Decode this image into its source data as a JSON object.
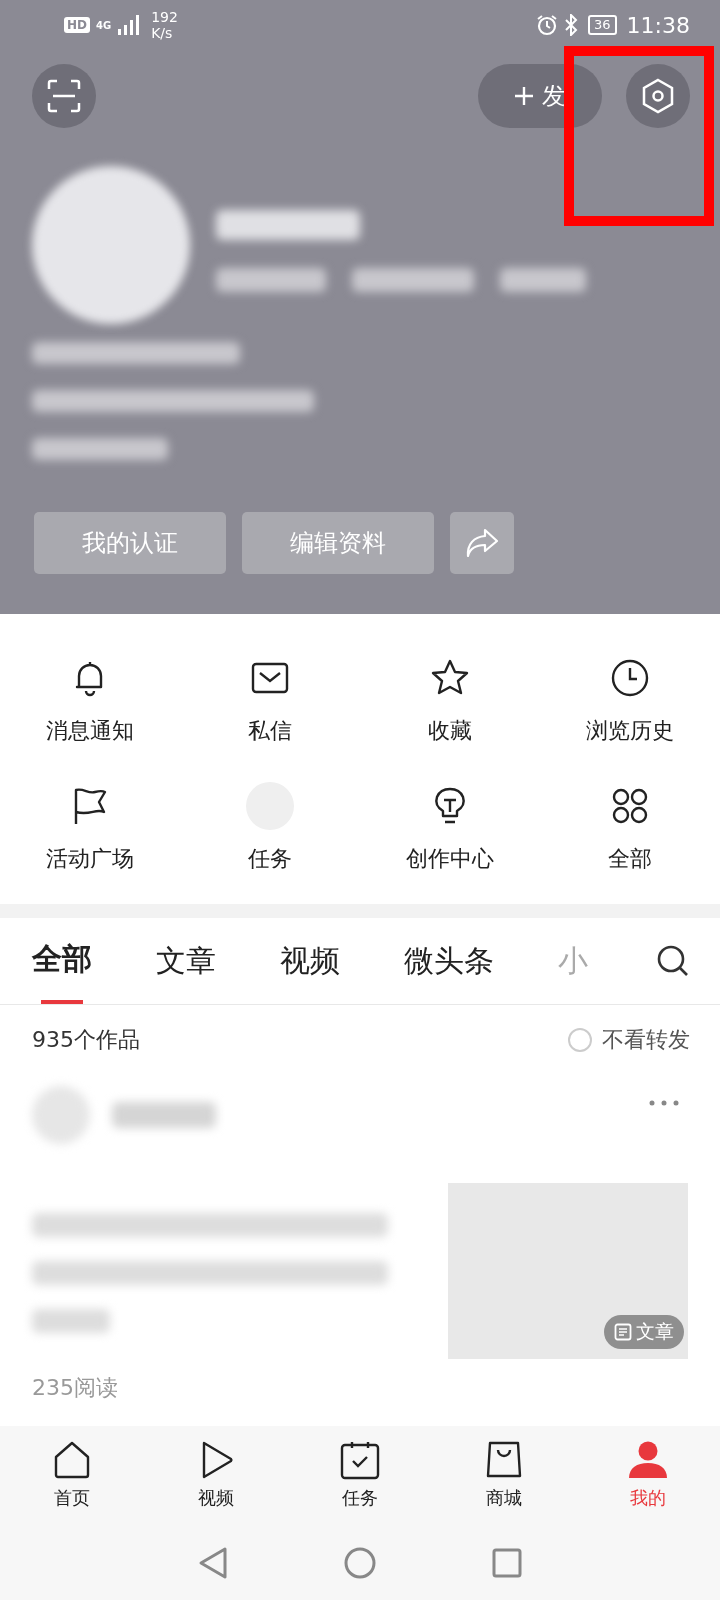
{
  "status_bar": {
    "hd": "HD",
    "signal": "4G",
    "network_speed": "192",
    "speed_unit": "K/s",
    "battery": "36",
    "time": "11:38"
  },
  "header": {
    "publish_label": "发",
    "highlight": true
  },
  "profile_buttons": [
    {
      "label": "我的认证"
    },
    {
      "label": "编辑资料"
    }
  ],
  "shortcuts": [
    {
      "label": "消息通知",
      "kind": "bell"
    },
    {
      "label": "私信",
      "kind": "mail"
    },
    {
      "label": "收藏",
      "kind": "star"
    },
    {
      "label": "浏览历史",
      "kind": "clock"
    },
    {
      "label": "活动广场",
      "kind": "flag"
    },
    {
      "label": "任务",
      "kind": "placeholder"
    },
    {
      "label": "创作中心",
      "kind": "bulb"
    },
    {
      "label": "全部",
      "kind": "grid"
    }
  ],
  "tabs": [
    {
      "label": "全部",
      "selected": true
    },
    {
      "label": "文章",
      "selected": false
    },
    {
      "label": "视频",
      "selected": false
    },
    {
      "label": "微头条",
      "selected": false
    },
    {
      "label": "小",
      "selected": false
    }
  ],
  "works": {
    "count": "935个作品",
    "filter": {
      "label": "不看转发",
      "checked": false
    }
  },
  "post": {
    "badge": "文章",
    "reads": "235阅读"
  },
  "bottom_nav": [
    {
      "label": "首页",
      "kind": "home",
      "selected": false
    },
    {
      "label": "视频",
      "kind": "play",
      "selected": false
    },
    {
      "label": "任务",
      "kind": "task",
      "selected": false
    },
    {
      "label": "商城",
      "kind": "bag",
      "selected": false
    },
    {
      "label": "我的",
      "kind": "person",
      "selected": true
    }
  ]
}
